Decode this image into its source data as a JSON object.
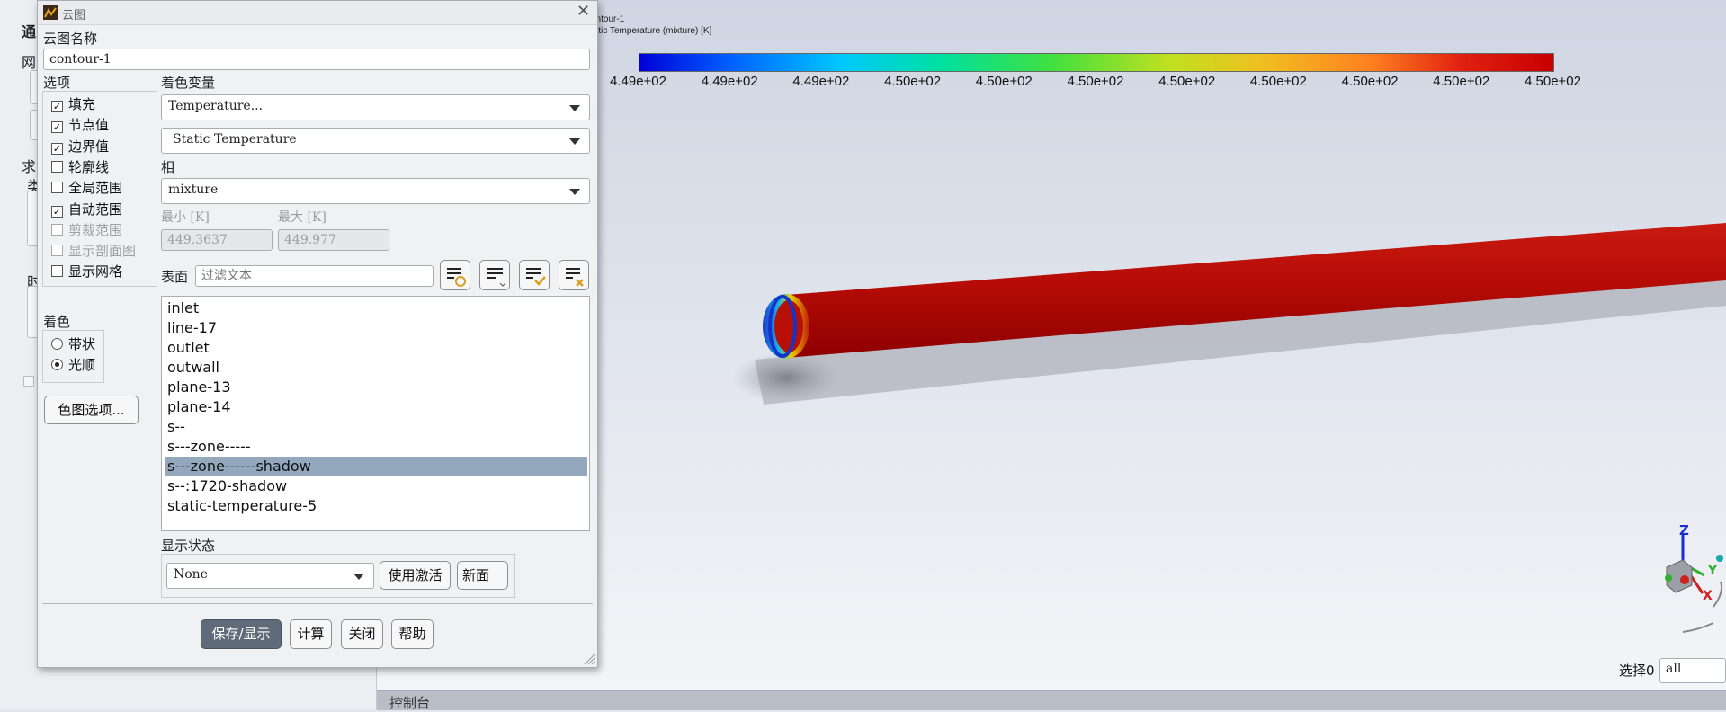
{
  "left_panel": {
    "labels": [
      "通",
      "网",
      "求",
      "类",
      "时"
    ]
  },
  "viewport": {
    "legend_title_line1": "ontour-1",
    "legend_title_line2": "tatic Temperature (mixture) [K]",
    "colorbar_ticks": [
      "4.49e+02",
      "4.49e+02",
      "4.49e+02",
      "4.50e+02",
      "4.50e+02",
      "4.50e+02",
      "4.50e+02",
      "4.50e+02",
      "4.50e+02",
      "4.50e+02",
      "4.50e+02"
    ],
    "selection_label": "选择0",
    "selection_value": "all",
    "axis_labels": {
      "z": "Z",
      "y": "Y",
      "x": "X"
    }
  },
  "console": {
    "label": "控制台"
  },
  "dialog": {
    "title": "云图",
    "name_label": "云图名称",
    "name_value": "contour-1",
    "options_label": "选项",
    "options": [
      {
        "label": "填充",
        "checked": true,
        "enabled": true
      },
      {
        "label": "节点值",
        "checked": true,
        "enabled": true
      },
      {
        "label": "边界值",
        "checked": true,
        "enabled": true
      },
      {
        "label": "轮廓线",
        "checked": false,
        "enabled": true
      },
      {
        "label": "全局范围",
        "checked": false,
        "enabled": true
      },
      {
        "label": "自动范围",
        "checked": true,
        "enabled": true
      },
      {
        "label": "剪裁范围",
        "checked": false,
        "enabled": false
      },
      {
        "label": "显示剖面图",
        "checked": false,
        "enabled": false
      },
      {
        "label": "显示网格",
        "checked": false,
        "enabled": true
      }
    ],
    "coloring_label": "着色",
    "coloring_options": [
      {
        "label": "带状",
        "selected": false
      },
      {
        "label": "光顺",
        "selected": true
      }
    ],
    "colormap_button": "色图选项...",
    "color_var_label": "着色变量",
    "color_var_category": "Temperature...",
    "color_var_field": "Static Temperature",
    "phase_label": "相",
    "phase_value": "mixture",
    "min_label": "最小 [K]",
    "max_label": "最大 [K]",
    "min_value": "449.3637",
    "max_value": "449.977",
    "surface_label": "表面",
    "surface_filter_placeholder": "过滤文本",
    "surfaces": [
      {
        "name": "inlet",
        "selected": false
      },
      {
        "name": "line-17",
        "selected": false
      },
      {
        "name": "outlet",
        "selected": false
      },
      {
        "name": "outwall",
        "selected": false
      },
      {
        "name": "plane-13",
        "selected": false
      },
      {
        "name": "plane-14",
        "selected": false
      },
      {
        "name": "s--",
        "selected": false
      },
      {
        "name": "s---zone-----",
        "selected": false
      },
      {
        "name": "s---zone------shadow",
        "selected": true
      },
      {
        "name": "s--:1720-shadow",
        "selected": false
      },
      {
        "name": "static-temperature-5",
        "selected": false
      }
    ],
    "display_state_label": "显示状态",
    "display_state_value": "None",
    "use_active_button": "使用激活",
    "new_button": "新面",
    "buttons": {
      "save_display": "保存/显示",
      "compute": "计算",
      "close": "关闭",
      "help": "帮助"
    }
  }
}
